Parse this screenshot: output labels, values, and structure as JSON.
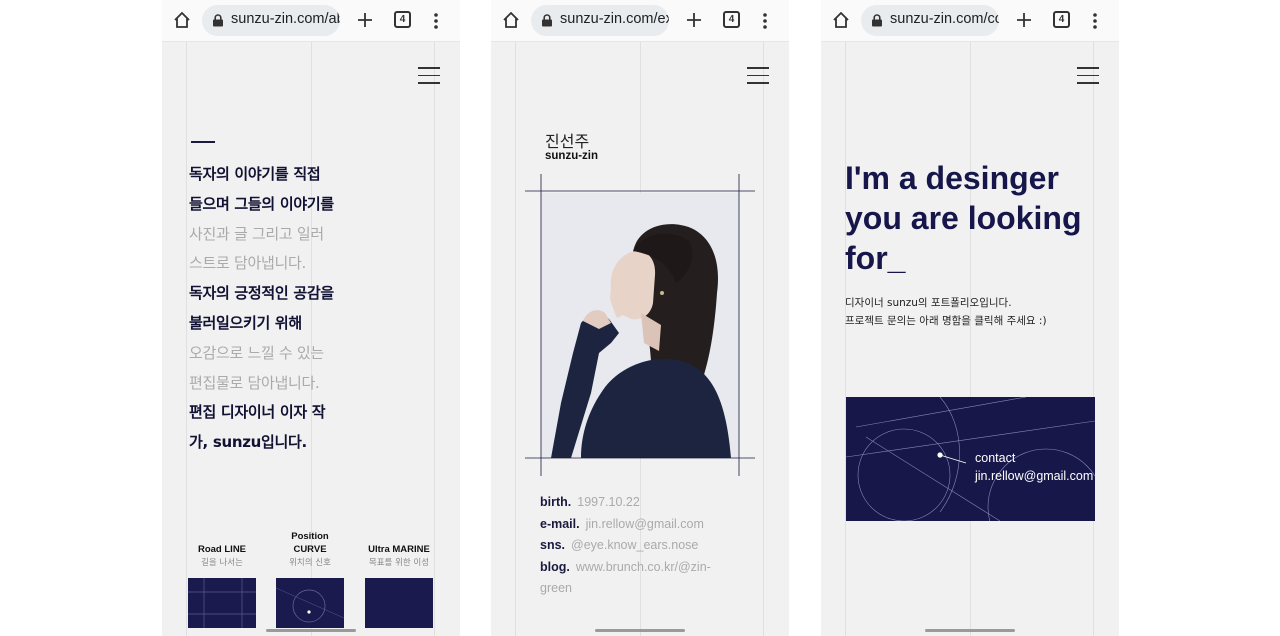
{
  "colors": {
    "navy": "#17174a",
    "page_bg": "#f1f1f1",
    "chrome_bg": "#fafafa",
    "muted_text": "#aaaaaa"
  },
  "browser": {
    "tab_count": "4",
    "icons": [
      "home-icon",
      "lock-icon",
      "plus-icon",
      "tabs-icon",
      "more-vert-icon"
    ]
  },
  "phones": [
    {
      "url": "sunzu-zin.com/ab",
      "intro_lines": [
        {
          "text": "독자의 이야기를 직접",
          "style": "dark"
        },
        {
          "text": "들으며 그들의 이야기를",
          "style": "dark"
        },
        {
          "text": "사진과 글 그리고 일러",
          "style": "gray"
        },
        {
          "text": "스트로 담아냅니다.",
          "style": "gray"
        },
        {
          "text": "독자의 긍정적인 공감을",
          "style": "dark"
        },
        {
          "text": "불러일으키기 위해",
          "style": "dark"
        },
        {
          "text": "오감으로 느낄 수 있는",
          "style": "gray"
        },
        {
          "text": "편집물로 담아냅니다.",
          "style": "gray"
        },
        {
          "text": "편집 디자이너 이자 작",
          "style": "dark"
        },
        {
          "text": "가, sunzu입니다.",
          "style": "dark"
        }
      ],
      "tiles": [
        {
          "title_1": "",
          "title_2": "Road LINE",
          "subtitle": "길을 나서는"
        },
        {
          "title_1": "Position",
          "title_2": "CURVE",
          "subtitle": "위치의 신호"
        },
        {
          "title_1": "",
          "title_2": "Ultra MARINE",
          "subtitle": "목표를 위한 이성"
        }
      ]
    },
    {
      "url": "sunzu-zin.com/ex",
      "name_ko": "진선주",
      "name_en": "sunzu-zin",
      "info": [
        {
          "label": "birth.",
          "value": "1997.10.22"
        },
        {
          "label": "e-mail.",
          "value": "jin.rellow@gmail.com"
        },
        {
          "label": "sns.",
          "value": "@eye.know_ears.nose"
        },
        {
          "label": "blog.",
          "value": "www.brunch.co.kr/@zin-",
          "value_cont": "green"
        }
      ]
    },
    {
      "url": "sunzu-zin.com/cc",
      "headline": [
        "I'm a desinger",
        "you are looking",
        "for_"
      ],
      "description": [
        "디자이너 sunzu의 포트폴리오입니다.",
        "프로젝트 문의는 아래 명함을 클릭해 주세요 :)"
      ],
      "card": {
        "label": "contact",
        "email": "jin.rellow@gmail.com"
      }
    }
  ]
}
